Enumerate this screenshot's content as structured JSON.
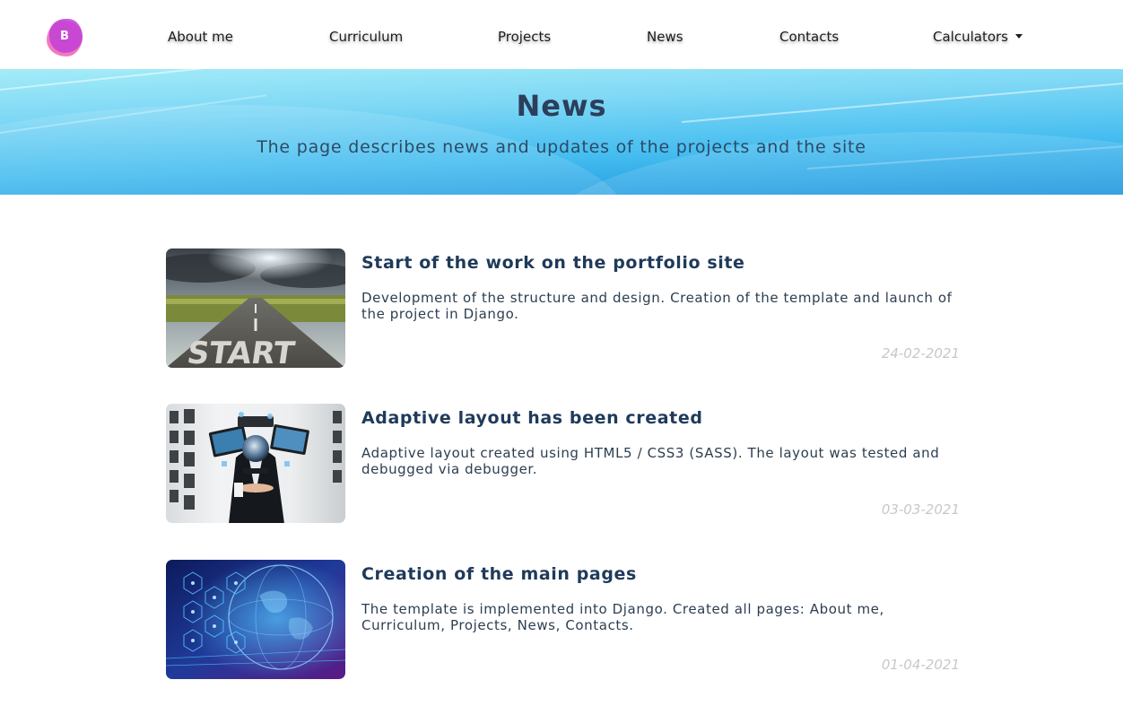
{
  "navbar": {
    "logo_letter": "B",
    "links": [
      {
        "label": "About me"
      },
      {
        "label": "Curriculum"
      },
      {
        "label": "Projects"
      },
      {
        "label": "News"
      },
      {
        "label": "Contacts"
      },
      {
        "label": "Calculators"
      }
    ]
  },
  "hero": {
    "title": "News",
    "subtitle": "The page describes news and updates of the projects and the site"
  },
  "news": [
    {
      "title": "Start of the work on the portfolio site",
      "description": "Development of the structure and design. Creation of the template and launch of the project in Django.",
      "date": "24-02-2021",
      "image_icon": "road-start-image",
      "start_text": "START"
    },
    {
      "title": "Adaptive layout has been created",
      "description": "Adaptive layout created using HTML5 / CSS3 (SASS). The layout was tested and debugged via debugger.",
      "date": "03-03-2021",
      "image_icon": "devices-hand-image"
    },
    {
      "title": "Creation of the main pages",
      "description": "The template is implemented into Django. Created all pages: About me, Curriculum, Projects, News, Contacts.",
      "date": "01-04-2021",
      "image_icon": "globe-network-image"
    }
  ],
  "colors": {
    "accent": "#1f3a5a",
    "hero_top": "#a4ecf8",
    "hero_bottom": "#1a94dd",
    "date": "#c8c8c8",
    "logo": "#c23fd6"
  }
}
